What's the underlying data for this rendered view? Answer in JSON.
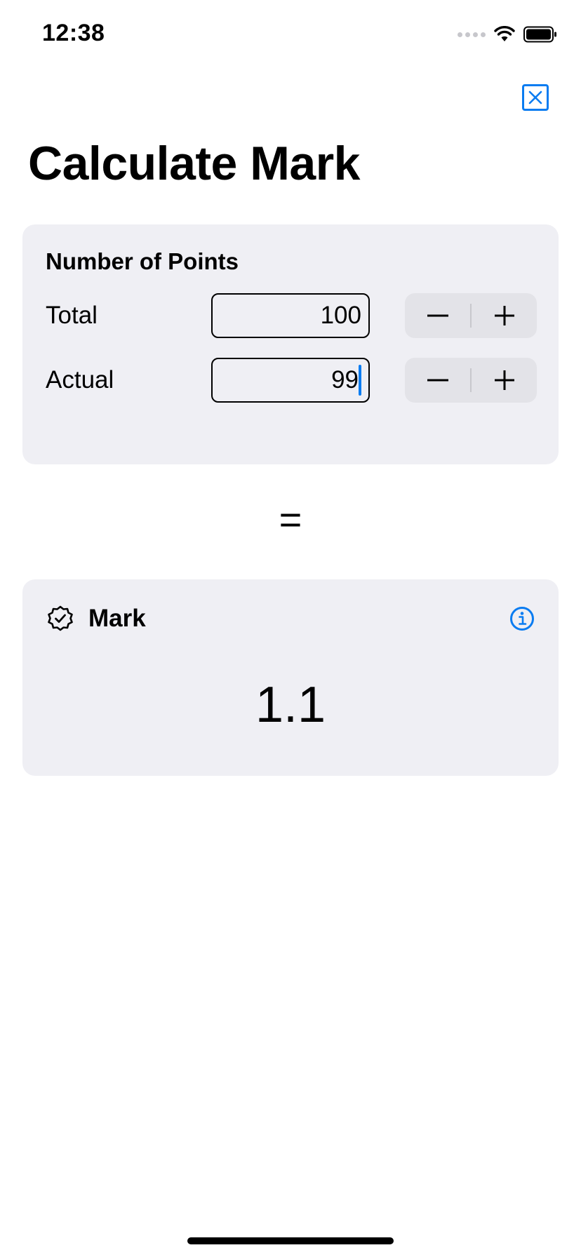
{
  "status_bar": {
    "time": "12:38"
  },
  "header": {
    "title": "Calculate Mark",
    "close_icon": "xmark-square-icon"
  },
  "points_section": {
    "header": "Number of Points",
    "rows": [
      {
        "label": "Total",
        "value": "100"
      },
      {
        "label": "Actual",
        "value": "99"
      }
    ],
    "stepper": {
      "minus": "−",
      "plus": "+"
    }
  },
  "equals_sign": "=",
  "mark_section": {
    "label": "Mark",
    "icon": "checkmark-seal-icon",
    "info_icon": "info-circle-icon",
    "value": "1.1"
  },
  "colors": {
    "accent": "#0a7cf1",
    "card_background": "#efeff4",
    "stepper_background": "#e3e3e8"
  }
}
